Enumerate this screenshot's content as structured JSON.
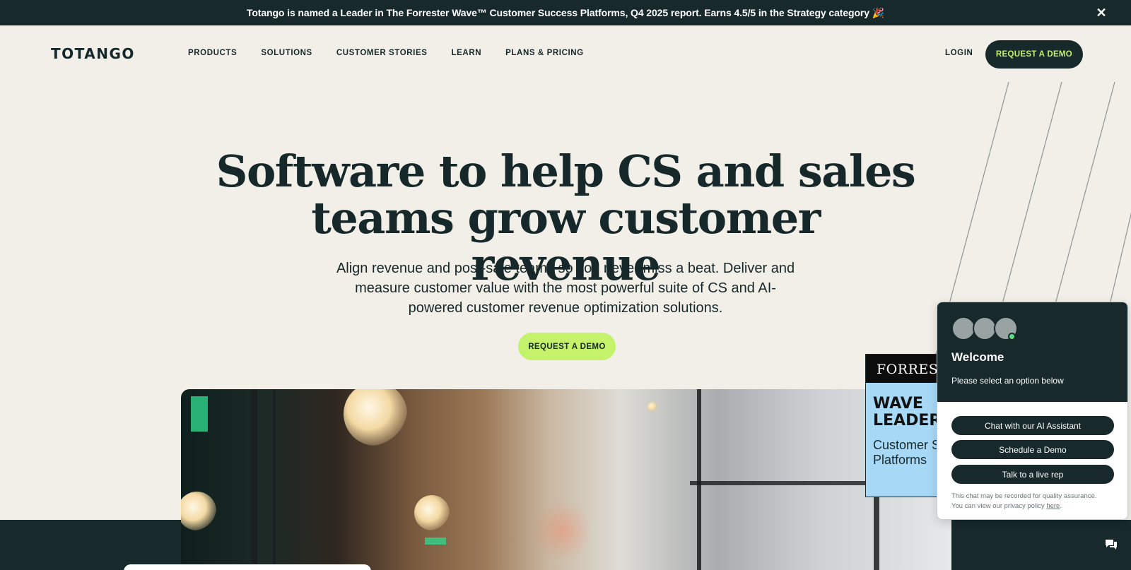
{
  "announcement": {
    "text": "Totango is named a Leader in The Forrester Wave™ Customer Success Platforms, Q4 2025 report. Earns 4.5/5 in the Strategy category 🎉",
    "close_icon": "✕"
  },
  "nav": {
    "logo": "TOTANGO",
    "items": [
      "PRODUCTS",
      "SOLUTIONS",
      "CUSTOMER STORIES",
      "LEARN",
      "PLANS & PRICING"
    ],
    "login": "LOGIN",
    "demo": "REQUEST A DEMO"
  },
  "hero": {
    "title_line1": "Software to help CS and sales",
    "title_line2": "teams grow customer revenue",
    "subtitle": "Align revenue and post-sale teams so you never miss a beat. Deliver and measure customer value with the most powerful suite of CS and AI-powered customer revenue optimization solutions.",
    "demo": "REQUEST A DEMO"
  },
  "badge": {
    "brand": "FORRESTER",
    "wave_line1": "WAVE",
    "wave_line2": "LEADER",
    "category_line1": "Customer Success",
    "category_line2": "Platforms"
  },
  "chat": {
    "welcome": "Welcome",
    "prompt": "Please select an option below",
    "options": [
      "Chat with our AI Assistant",
      "Schedule a Demo",
      "Talk to a live rep"
    ],
    "disclaimer_line1": "This chat may be recorded for quality assurance.",
    "disclaimer_line2": "You can view our privacy policy",
    "disclaimer_link": "here",
    "launcher_icon": "chat-bubbles-icon"
  },
  "colors": {
    "dark": "#17292b",
    "accent_lime": "#c4f26a",
    "background": "#f1efe8"
  }
}
